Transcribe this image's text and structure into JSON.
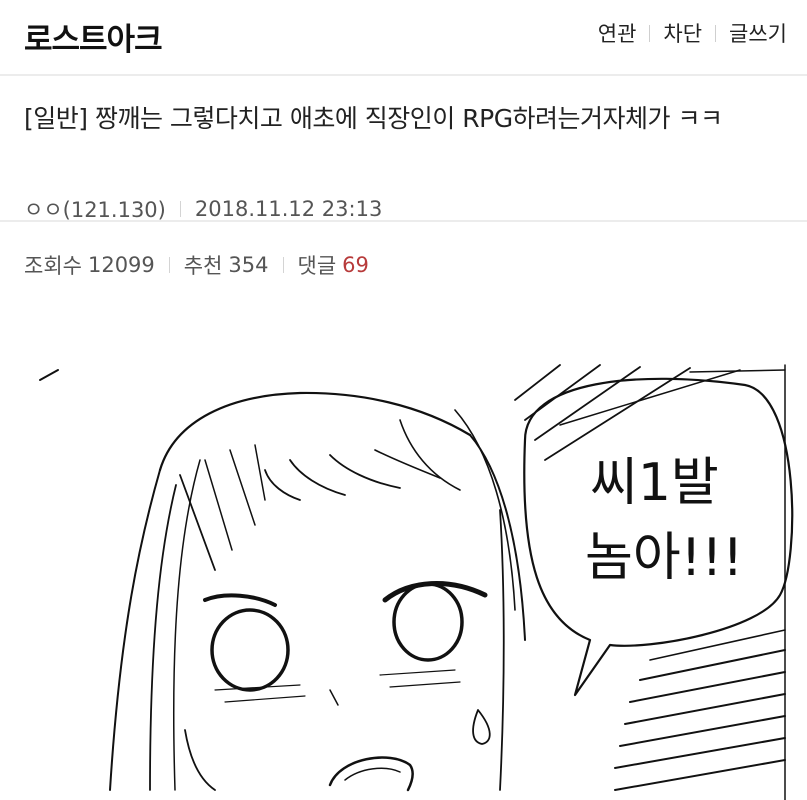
{
  "header": {
    "site_title": "로스트아크",
    "nav": [
      {
        "label": "연관"
      },
      {
        "label": "차단"
      },
      {
        "label": "글쓰기"
      }
    ]
  },
  "post": {
    "title": "[일반] 짱깨는 그렇다치고 애초에 직장인이 RPG하려는거자체가 ㅋㅋ",
    "author": "ㅇㅇ(121.130)",
    "datetime": "2018.11.12 23:13"
  },
  "stats": {
    "views_label": "조회수",
    "views": "12099",
    "recommend_label": "추천",
    "recommend": "354",
    "comments_label": "댓글",
    "comments": "69",
    "comments_color": "#b73a3a"
  },
  "comic": {
    "speech_line1": "씨1발",
    "speech_line2": "놈아!!!"
  }
}
